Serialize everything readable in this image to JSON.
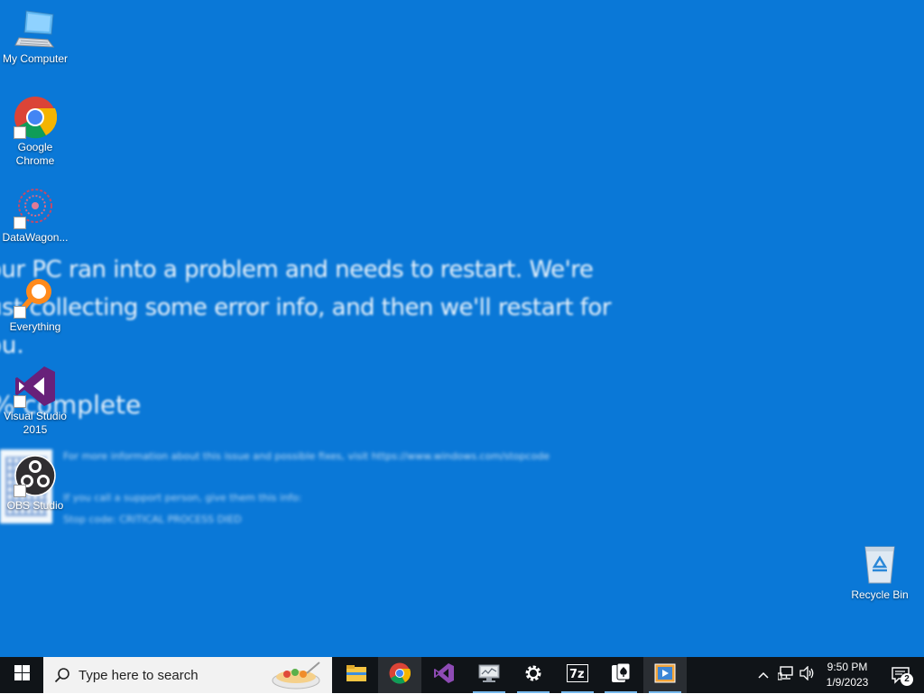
{
  "wallpaper": {
    "line1": "our PC ran into a problem and needs to restart. We're",
    "line2": "ust collecting some error info, and then we'll restart for",
    "line3": "ou.",
    "percent": "% complete",
    "info1": "For more information about this issue and possible fixes, visit https://www.windows.com/stopcode",
    "info2": "If you call a support person, give them this info:",
    "info3": "Stop code: CRITICAL PROCESS DIED"
  },
  "desktop_icons": [
    {
      "label": "My Computer",
      "icon": "computer-icon"
    },
    {
      "label": "Google Chrome",
      "icon": "chrome-icon"
    },
    {
      "label": "DataWagon...",
      "icon": "datawagon-icon"
    },
    {
      "label": "Everything",
      "icon": "everything-search-icon"
    },
    {
      "label": "Visual Studio 2015",
      "icon": "visual-studio-icon"
    },
    {
      "label": "OBS Studio",
      "icon": "obs-icon"
    },
    {
      "label": "Recycle Bin",
      "icon": "recycle-bin-icon"
    }
  ],
  "taskbar": {
    "search_placeholder": "Type here to search",
    "apps": [
      {
        "name": "File Explorer",
        "icon": "folder-icon"
      },
      {
        "name": "Google Chrome",
        "icon": "chrome-icon"
      },
      {
        "name": "Visual Studio",
        "icon": "visual-studio-icon"
      },
      {
        "name": "Network Monitor",
        "icon": "monitor-icon"
      },
      {
        "name": "Settings",
        "icon": "gear-icon"
      },
      {
        "name": "7-Zip",
        "icon": "7zip-icon"
      },
      {
        "name": "Solitaire",
        "icon": "cards-icon"
      },
      {
        "name": "Media Player",
        "icon": "media-player-icon"
      }
    ],
    "clock_time": "9:50 PM",
    "clock_date": "1/9/2023",
    "notification_count": "2"
  },
  "colors": {
    "desktop": "#0a78d7",
    "taskbar": "#101418",
    "active_indicator": "#76b9ed"
  }
}
